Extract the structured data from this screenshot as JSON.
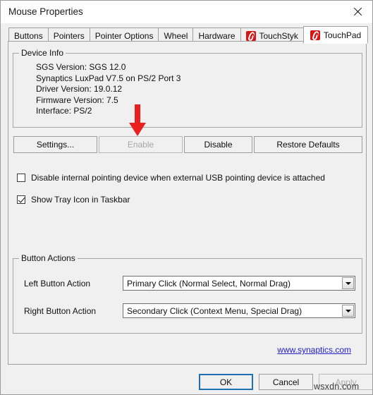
{
  "window": {
    "title": "Mouse Properties",
    "close_icon": "close-icon"
  },
  "tabs": [
    {
      "label": "Buttons",
      "active": false,
      "icon": null
    },
    {
      "label": "Pointers",
      "active": false,
      "icon": null
    },
    {
      "label": "Pointer Options",
      "active": false,
      "icon": null
    },
    {
      "label": "Wheel",
      "active": false,
      "icon": null
    },
    {
      "label": "Hardware",
      "active": false,
      "icon": null
    },
    {
      "label": "TouchStyk",
      "active": false,
      "icon": "synaptics-logo-icon"
    },
    {
      "label": "TouchPad",
      "active": true,
      "icon": "synaptics-logo-icon"
    }
  ],
  "device_info": {
    "legend": "Device Info",
    "lines": [
      "SGS Version: SGS 12.0",
      "Synaptics LuxPad V7.5 on PS/2 Port 3",
      "Driver Version: 19.0.12",
      "Firmware Version: 7.5",
      "Interface: PS/2"
    ]
  },
  "annotation": {
    "arrow_color": "#e8201f",
    "points_at": "Enable"
  },
  "device_buttons": [
    {
      "label": "Settings...",
      "disabled": false
    },
    {
      "label": "Enable",
      "disabled": true
    },
    {
      "label": "Disable",
      "disabled": false
    },
    {
      "label": "Restore Defaults",
      "disabled": false
    }
  ],
  "checkboxes": [
    {
      "label": "Disable internal pointing device when external USB pointing device is attached",
      "checked": false
    },
    {
      "label": "Show Tray Icon in Taskbar",
      "checked": true
    }
  ],
  "button_actions": {
    "legend": "Button Actions",
    "rows": [
      {
        "label": "Left Button Action",
        "value": "Primary Click (Normal Select, Normal Drag)"
      },
      {
        "label": "Right Button Action",
        "value": "Secondary Click (Context Menu, Special Drag)"
      }
    ]
  },
  "link": {
    "text": "www.synaptics.com",
    "color": "#2222c8"
  },
  "dialog_buttons": [
    {
      "label": "OK",
      "default": true,
      "disabled": false
    },
    {
      "label": "Cancel",
      "default": false,
      "disabled": false
    },
    {
      "label": "Apply",
      "default": false,
      "disabled": true
    }
  ],
  "watermark": "wsxdn.com"
}
